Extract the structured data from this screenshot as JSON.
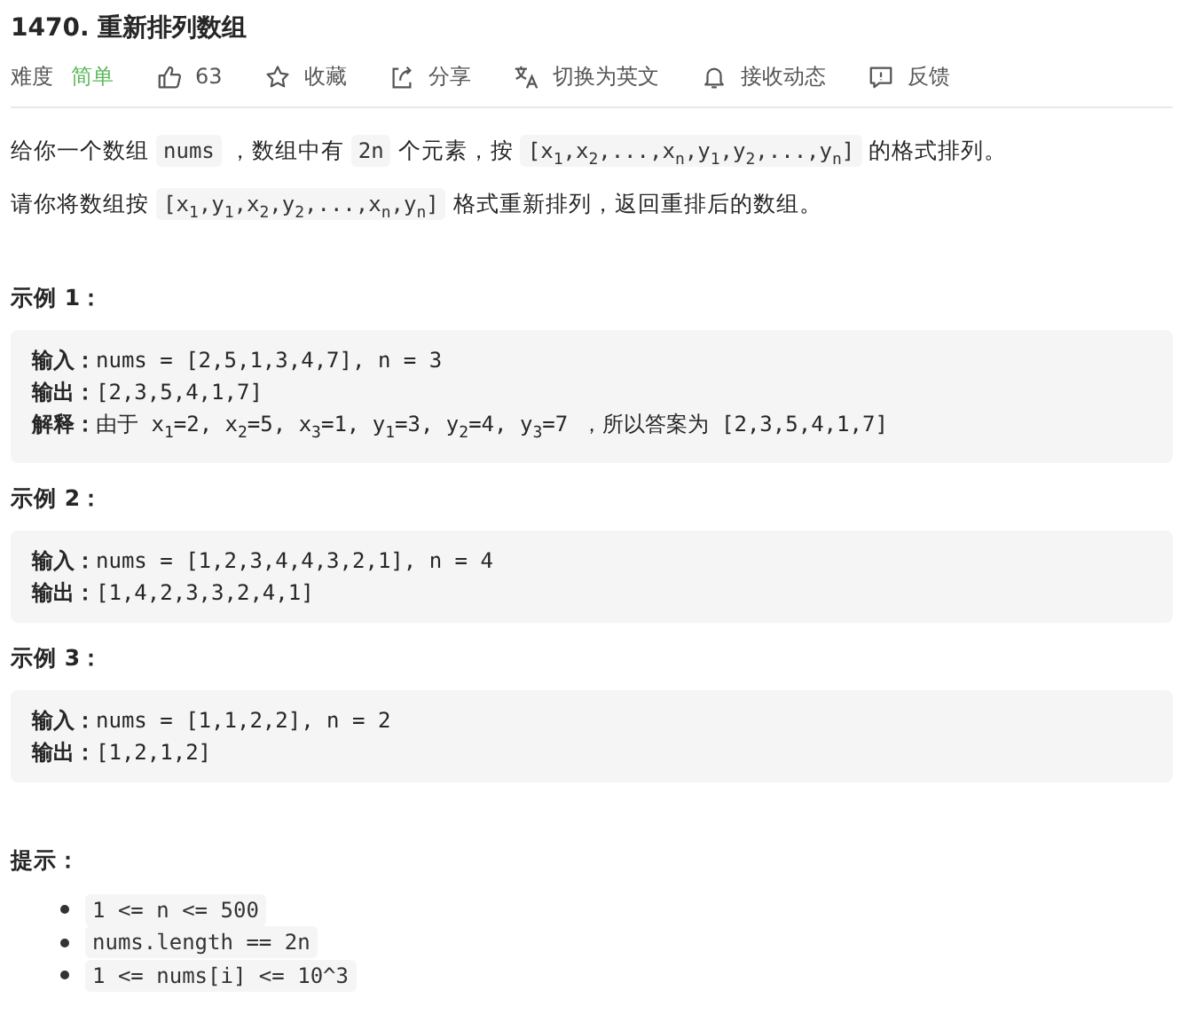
{
  "title": "1470. 重新排列数组",
  "meta": {
    "difficulty_label": "难度",
    "difficulty": "简单",
    "actions": [
      {
        "kind": "like",
        "label": "63"
      },
      {
        "kind": "star",
        "label": "收藏"
      },
      {
        "kind": "share",
        "label": "分享"
      },
      {
        "kind": "translate",
        "label": "切换为英文"
      },
      {
        "kind": "bell",
        "label": "接收动态"
      },
      {
        "kind": "feedback",
        "label": "反馈"
      }
    ]
  },
  "description": [
    [
      {
        "kind": "text",
        "text": "给你一个数组"
      },
      {
        "kind": "code",
        "text": "nums"
      },
      {
        "kind": "text",
        "text": "，数组中有"
      },
      {
        "kind": "code",
        "text": "2n"
      },
      {
        "kind": "text",
        "text": "个元素，按"
      },
      {
        "kind": "code",
        "text": "[x$_{1}$,x$_{2}$,...,x$_{n}$,y$_{1}$,y$_{2}$,...,y$_{n}$]"
      },
      {
        "kind": "text",
        "text": "的格式排列。"
      }
    ],
    [
      {
        "kind": "text",
        "text": "请你将数组按"
      },
      {
        "kind": "code",
        "text": "[x$_{1}$,y$_{1}$,x$_{2}$,y$_{2}$,...,x$_{n}$,y$_{n}$]"
      },
      {
        "kind": "text",
        "text": "格式重新排列，返回重排后的数组。"
      }
    ]
  ],
  "examples": [
    {
      "title": "示例 1：",
      "lines": [
        {
          "label": "输入：",
          "text": "nums = [2,5,1,3,4,7], n = 3"
        },
        {
          "label": "输出：",
          "text": "[2,3,5,4,1,7]"
        },
        {
          "label": "解释：",
          "text": "由于 x$_{1}$=2, x$_{2}$=5, x$_{3}$=1, y$_{1}$=3, y$_{2}$=4, y$_{3}$=7 ，所以答案为 [2,3,5,4,1,7]"
        }
      ]
    },
    {
      "title": "示例 2：",
      "lines": [
        {
          "label": "输入：",
          "text": "nums = [1,2,3,4,4,3,2,1], n = 4"
        },
        {
          "label": "输出：",
          "text": "[1,4,2,3,3,2,4,1]"
        }
      ]
    },
    {
      "title": "示例 3：",
      "lines": [
        {
          "label": "输入：",
          "text": "nums = [1,1,2,2], n = 2"
        },
        {
          "label": "输出：",
          "text": "[1,2,1,2]"
        }
      ]
    }
  ],
  "hints": {
    "title": "提示：",
    "items": [
      "1 <= n <= 500",
      "nums.length == 2n",
      "1 <= nums[i] <= 10^3"
    ]
  }
}
